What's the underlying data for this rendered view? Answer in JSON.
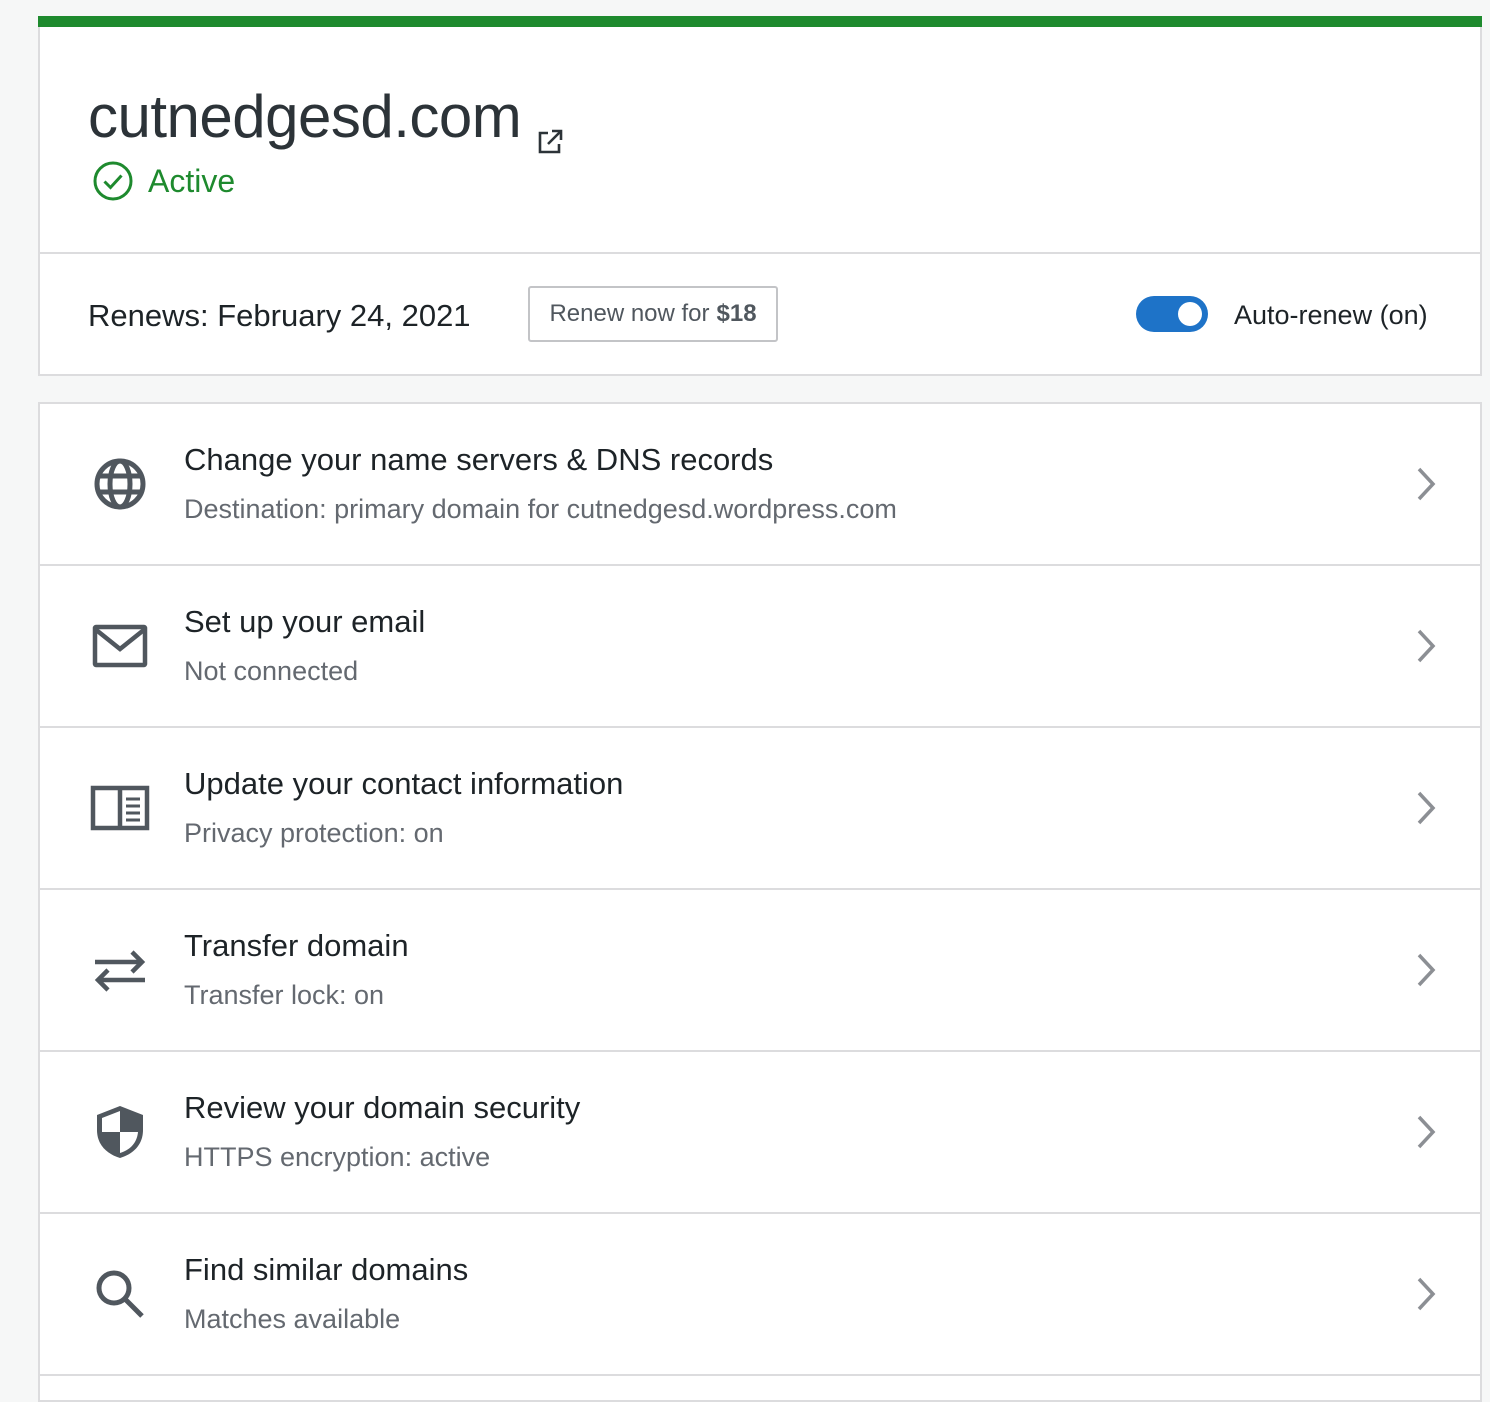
{
  "domain": {
    "name": "cutnedgesd.com",
    "status": "Active"
  },
  "renewal": {
    "renews_label": "Renews: February 24, 2021",
    "renew_button_prefix": "Renew now for",
    "renew_button_price": "$18",
    "auto_renew_label": "Auto-renew (on)",
    "auto_renew_on": true
  },
  "actions": [
    {
      "icon": "globe-icon",
      "title": "Change your name servers & DNS records",
      "subtitle": "Destination: primary domain for cutnedgesd.wordpress.com"
    },
    {
      "icon": "mail-icon",
      "title": "Set up your email",
      "subtitle": "Not connected"
    },
    {
      "icon": "contact-card-icon",
      "title": "Update your contact information",
      "subtitle": "Privacy protection: on"
    },
    {
      "icon": "transfer-arrows-icon",
      "title": "Transfer domain",
      "subtitle": "Transfer lock: on"
    },
    {
      "icon": "shield-icon",
      "title": "Review your domain security",
      "subtitle": "HTTPS encryption: active"
    },
    {
      "icon": "search-icon",
      "title": "Find similar domains",
      "subtitle": "Matches available"
    }
  ],
  "colors": {
    "accent_green": "#1e8a2e",
    "toggle_blue": "#1e73c8",
    "text_primary": "#1d2327",
    "text_secondary": "#646970",
    "border": "#dcdcde"
  }
}
